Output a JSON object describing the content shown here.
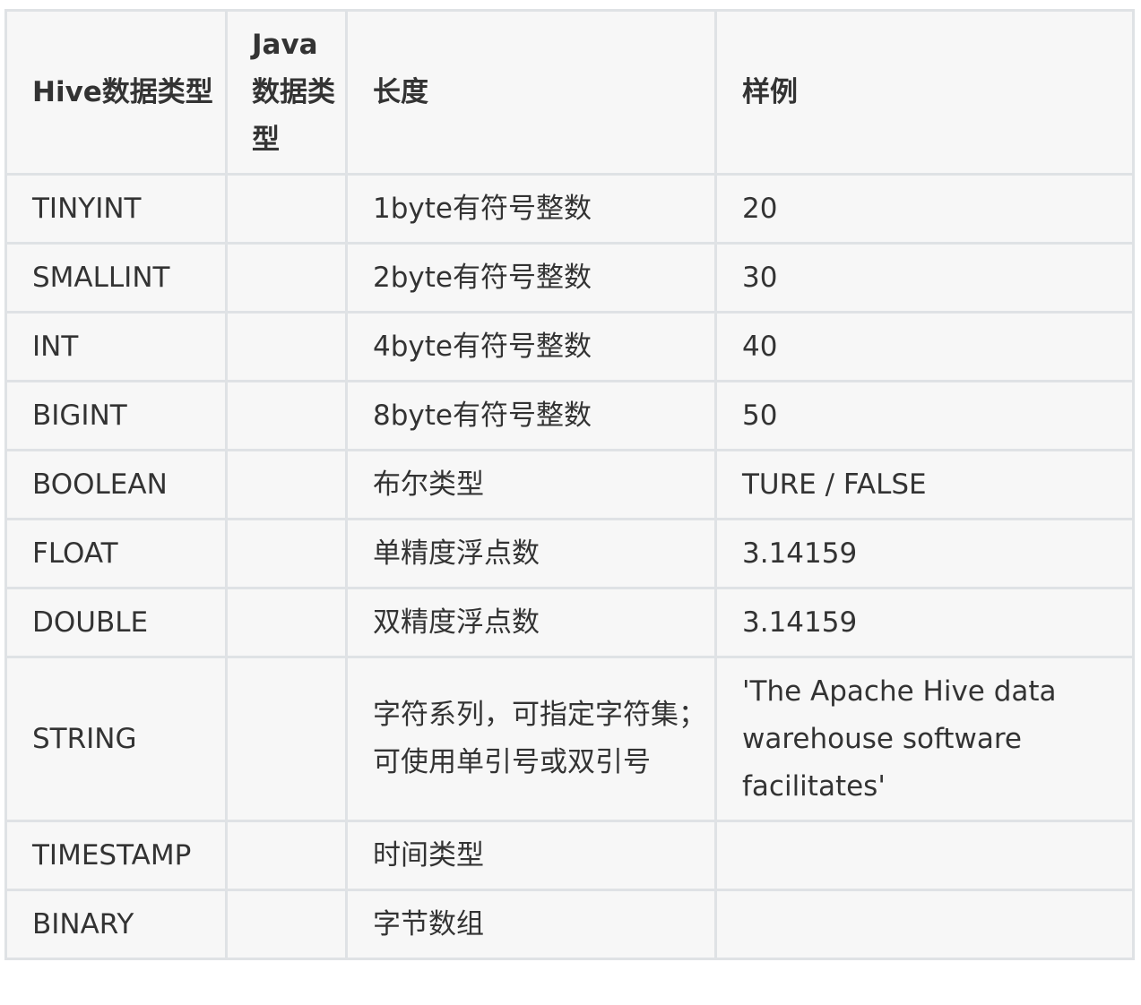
{
  "table": {
    "headers": [
      "Hive数据类型",
      "Java数据类型",
      "长度",
      "样例"
    ],
    "rows": [
      [
        "TINYINT",
        "",
        "1byte有符号整数",
        "20"
      ],
      [
        "SMALLINT",
        "",
        "2byte有符号整数",
        "30"
      ],
      [
        "INT",
        "",
        "4byte有符号整数",
        "40"
      ],
      [
        "BIGINT",
        "",
        "8byte有符号整数",
        "50"
      ],
      [
        "BOOLEAN",
        "",
        "布尔类型",
        "TURE / FALSE"
      ],
      [
        "FLOAT",
        "",
        "单精度浮点数",
        "3.14159"
      ],
      [
        "DOUBLE",
        "",
        "双精度浮点数",
        "3.14159"
      ],
      [
        "STRING",
        "",
        "字符系列，可指定字符集；可使用单引号或双引号",
        "'The Apache Hive data warehouse software facilitates'"
      ],
      [
        "TIMESTAMP",
        "",
        "时间类型",
        ""
      ],
      [
        "BINARY",
        "",
        "字节数组",
        ""
      ]
    ]
  }
}
